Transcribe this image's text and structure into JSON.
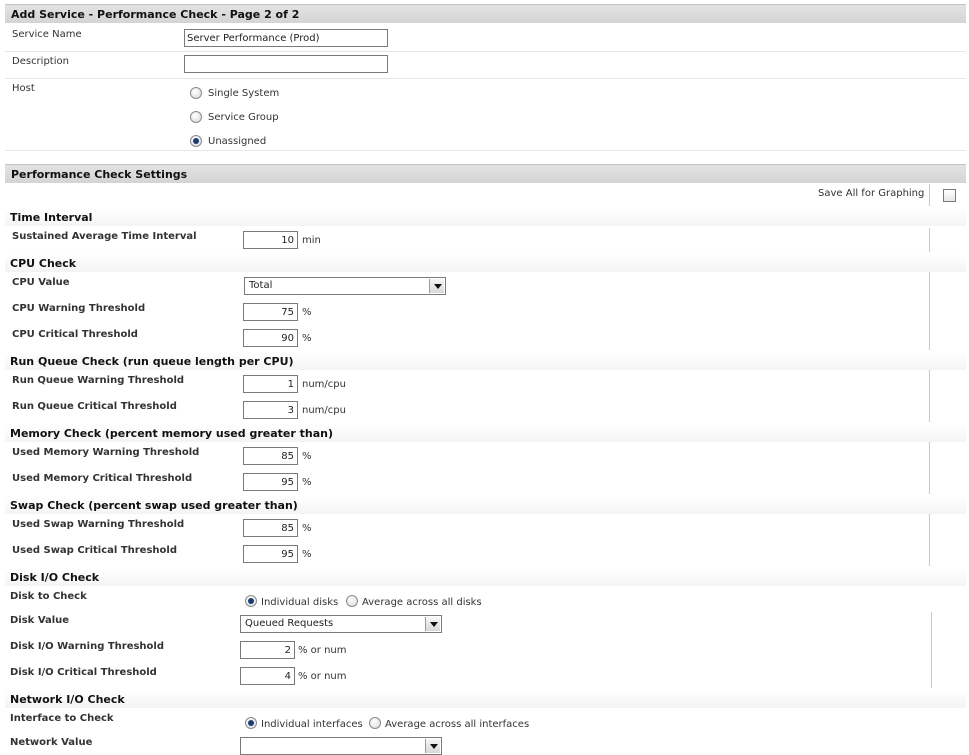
{
  "page_header": "Add Service - Performance Check - Page 2 of 2",
  "service_name": {
    "label": "Service Name",
    "value": "Server Performance (Prod)"
  },
  "description": {
    "label": "Description",
    "value": ""
  },
  "host": {
    "label": "Host",
    "options": [
      "Single System",
      "Service Group",
      "Unassigned"
    ],
    "selected": "Unassigned"
  },
  "settings_header": "Performance Check Settings",
  "save_all_label": "Save All for Graphing",
  "time_interval": {
    "title": "Time Interval",
    "sustained_label": "Sustained Average Time Interval",
    "sustained_value": "10",
    "sustained_unit": "min"
  },
  "cpu": {
    "title": "CPU Check",
    "value_label": "CPU Value",
    "value_selected": "Total",
    "warning_label": "CPU Warning Threshold",
    "warning_value": "75",
    "critical_label": "CPU Critical Threshold",
    "critical_value": "90",
    "unit": "%"
  },
  "run_queue": {
    "title": "Run Queue Check (run queue length per CPU)",
    "warning_label": "Run Queue Warning Threshold",
    "warning_value": "1",
    "critical_label": "Run Queue Critical Threshold",
    "critical_value": "3",
    "unit": "num/cpu"
  },
  "memory": {
    "title": "Memory Check (percent memory used greater than)",
    "warning_label": "Used Memory Warning Threshold",
    "warning_value": "85",
    "critical_label": "Used Memory Critical Threshold",
    "critical_value": "95",
    "unit": "%"
  },
  "swap": {
    "title": "Swap Check (percent swap used greater than)",
    "warning_label": "Used Swap Warning Threshold",
    "warning_value": "85",
    "critical_label": "Used Swap Critical Threshold",
    "critical_value": "95",
    "unit": "%"
  },
  "disk_io": {
    "title": "Disk I/O Check",
    "disk_label": "Disk to Check",
    "disk_options": [
      "Individual disks",
      "Average across all disks"
    ],
    "disk_selected": "Individual disks",
    "value_label": "Disk Value",
    "value_selected": "Queued Requests",
    "warning_label": "Disk I/O Warning Threshold",
    "warning_value": "2",
    "critical_label": "Disk I/O Critical Threshold",
    "critical_value": "4",
    "unit": "% or num"
  },
  "network_io": {
    "title": "Network I/O Check",
    "interface_label": "Interface to Check",
    "interface_options": [
      "Individual interfaces",
      "Average across all interfaces"
    ],
    "interface_selected": "Individual interfaces",
    "value_label": "Network Value"
  }
}
